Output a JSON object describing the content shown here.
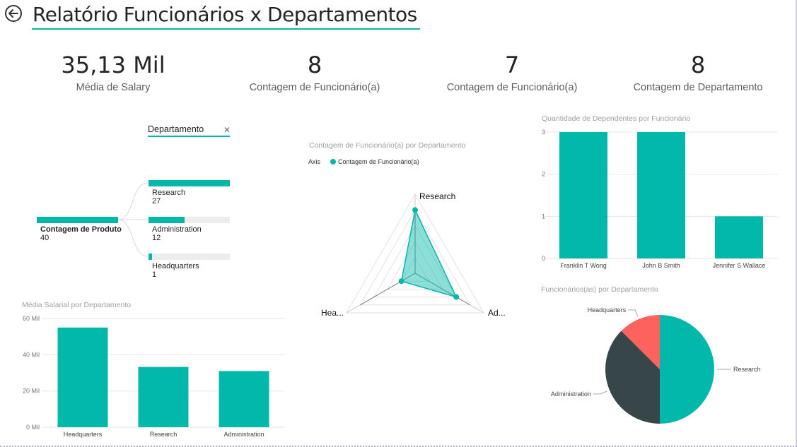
{
  "page": {
    "title": "Relatório Funcionários x Departamentos"
  },
  "kpis": [
    {
      "value": "35,13 Mil",
      "label": "Média de Salary"
    },
    {
      "value": "8",
      "label": "Contagem de Funcionário(a)"
    },
    {
      "value": "7",
      "label": "Contagem de Funcionário(a)"
    },
    {
      "value": "8",
      "label": "Contagem de Departamento"
    }
  ],
  "decomposition_tree": {
    "header": "Departamento",
    "close_icon": "close-icon",
    "root": {
      "label": "Contagem de Produto",
      "value": "40"
    },
    "nodes": [
      {
        "label": "Research",
        "value": "27",
        "fraction": 1.0
      },
      {
        "label": "Administration",
        "value": "12",
        "fraction": 0.444
      },
      {
        "label": "Headquarters",
        "value": "1",
        "fraction": 0.037
      }
    ]
  },
  "colors": {
    "teal": "#01b8aa",
    "dark": "#374649",
    "coral": "#fd625e",
    "grid": "#e6e6e6"
  },
  "chart_data": [
    {
      "type": "radar",
      "title": "Contagem de Funcionário(a) por Departamento",
      "legend_title": "Axis",
      "legend_position": "top-left",
      "axes": [
        "Research",
        "Ad...",
        "Hea..."
      ],
      "series": [
        {
          "name": "Contagem de Funcionário(a)",
          "values": [
            4,
            3,
            1
          ]
        }
      ],
      "max": 5
    },
    {
      "type": "bar",
      "title": "Quantidade de Dependentes por Funcionário",
      "categories": [
        "Franklin T Wong",
        "John B Smith",
        "Jennifer S Wallace"
      ],
      "values": [
        3,
        3,
        1
      ],
      "yticks": [
        "0",
        "1",
        "2",
        "3"
      ],
      "ylim": [
        0,
        3
      ],
      "grid": true
    },
    {
      "type": "bar",
      "title": "Média Salarial por Departamento",
      "categories": [
        "Headquarters",
        "Research",
        "Administration"
      ],
      "values": [
        55000,
        33250,
        31000
      ],
      "yticks": [
        "0 Mil",
        "20 Mil",
        "40 Mil",
        "60 Mil"
      ],
      "ylim": [
        0,
        60000
      ],
      "grid": true
    },
    {
      "type": "pie",
      "title": "Funcionários(as) por Departamento",
      "labels": [
        "Research",
        "Administration",
        "Headquarters"
      ],
      "values": [
        4,
        3,
        1
      ]
    }
  ]
}
